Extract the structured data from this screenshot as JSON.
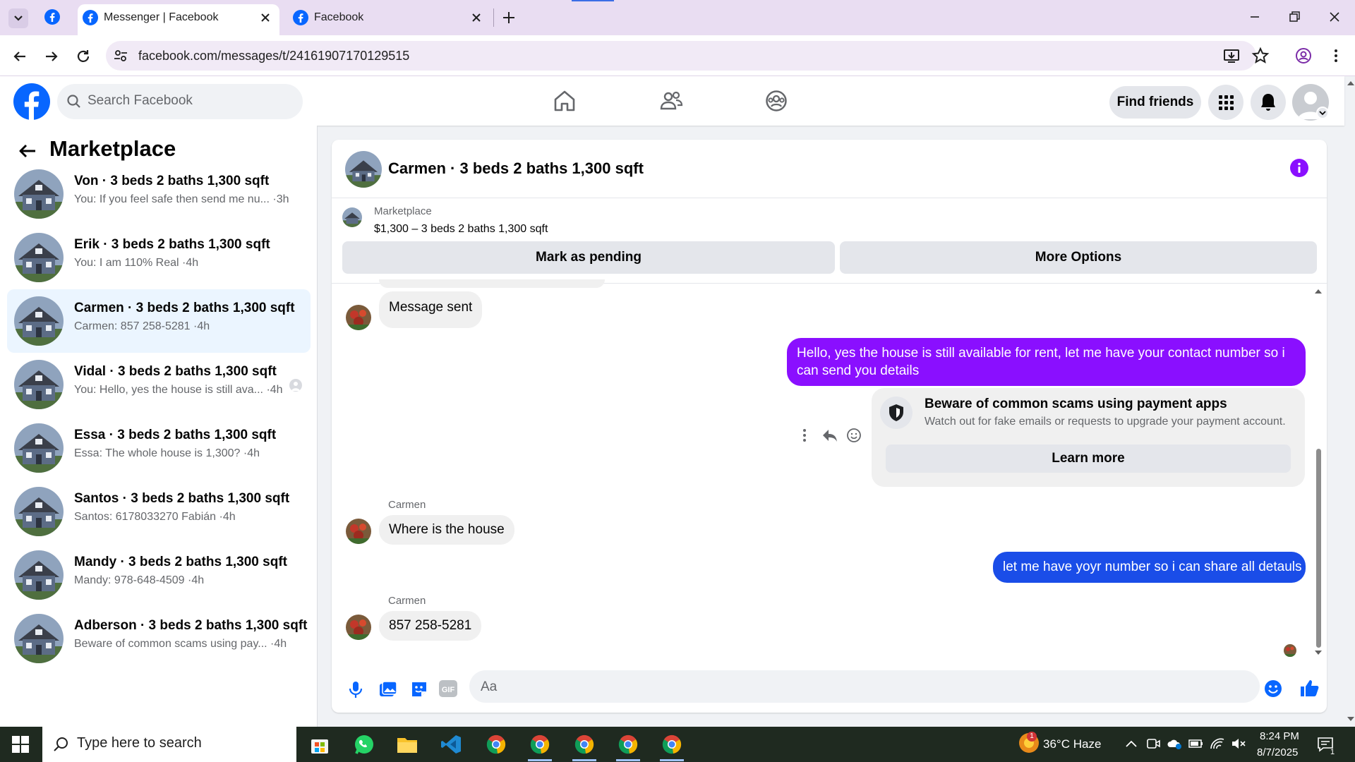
{
  "browser": {
    "tabs": [
      {
        "title": "Messenger | Facebook",
        "active": true
      },
      {
        "title": "Facebook",
        "active": false
      }
    ],
    "url": "facebook.com/messages/t/24161907170129515"
  },
  "header": {
    "search_placeholder": "Search Facebook",
    "find_friends_label": "Find friends"
  },
  "sidebar": {
    "title": "Marketplace",
    "conversations": [
      {
        "name": "Von · 3 beds 2 baths 1,300 sqft",
        "snippet": "You: If you feel safe then send me nu...",
        "time": "·3h",
        "active": false
      },
      {
        "name": "Erik · 3 beds 2 baths 1,300 sqft",
        "snippet": "You: I am 110% Real",
        "time": "·4h",
        "active": false
      },
      {
        "name": "Carmen · 3 beds 2 baths 1,300 sqft",
        "snippet": "Carmen: 857 258-5281",
        "time": "·4h",
        "active": true
      },
      {
        "name": "Vidal · 3 beds 2 baths 1,300 sqft",
        "snippet": "You: Hello, yes the house is still ava...",
        "time": "·4h",
        "active": false
      },
      {
        "name": "Essa · 3 beds 2 baths 1,300 sqft",
        "snippet": "Essa: The whole house is 1,300?",
        "time": "·4h",
        "active": false
      },
      {
        "name": "Santos · 3 beds 2 baths 1,300 sqft",
        "snippet": "Santos: 6178033270 Fabián",
        "time": "·4h",
        "active": false
      },
      {
        "name": "Mandy · 3 beds 2 baths 1,300 sqft",
        "snippet": "Mandy: 978-648-4509",
        "time": "·4h",
        "active": false
      },
      {
        "name": "Adberson · 3 beds 2 baths 1,300 sqft",
        "snippet": "Beware of common scams using pay...",
        "time": "·4h",
        "active": false
      }
    ]
  },
  "chat": {
    "title": "Carmen · 3 beds 2 baths 1,300 sqft",
    "listing_label": "Marketplace",
    "listing_price": "$1,300 – 3 beds 2 baths 1,300 sqft",
    "mark_pending_label": "Mark as pending",
    "more_options_label": "More Options",
    "messages": {
      "m1": "Message sent",
      "m2": "Hello, yes the house is still available for rent, let me have your contact number so i can send you  details",
      "warning_title": "Beware of common scams using payment apps",
      "warning_body": "Watch out for fake emails or requests to upgrade your payment account.",
      "learn_more": "Learn more",
      "sender3": "Carmen",
      "m3": "Where is the house",
      "m4": "let me have yoyr number so i can share all detauls",
      "sender5": "Carmen",
      "m5": "857 258-5281"
    },
    "composer_placeholder": "Aa"
  },
  "taskbar": {
    "search_placeholder": "Type here to search",
    "weather": "36°C Haze",
    "time": "8:24 PM",
    "date": "8/7/2025",
    "weather_badge": "1",
    "notif_count": "1"
  },
  "colors": {
    "fb_blue": "#0866ff",
    "bubble_purple": "#8a0fff",
    "bubble_blue": "#1a4de8",
    "chrome_tab_bg": "#e9ddf2"
  }
}
